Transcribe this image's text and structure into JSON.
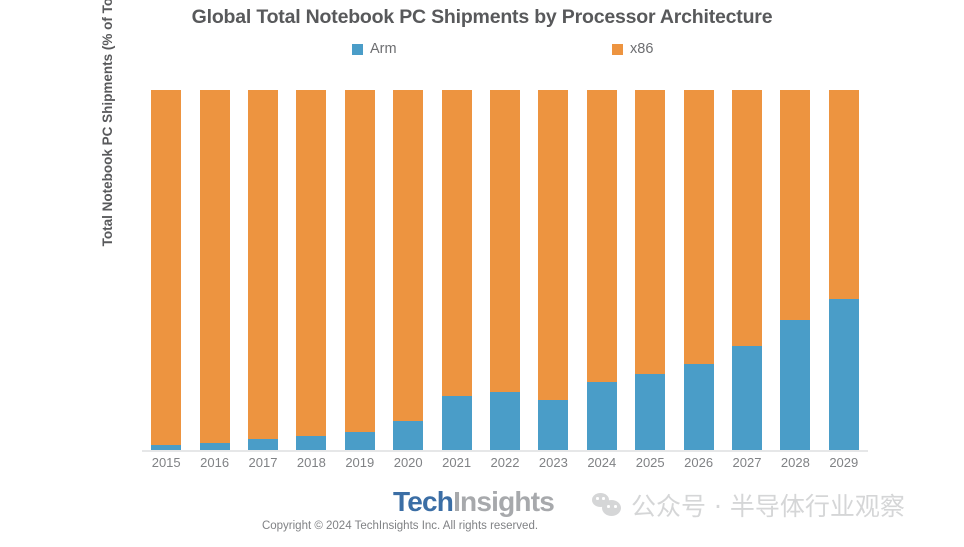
{
  "chart_data": {
    "type": "bar",
    "subtype": "stacked-100-percent",
    "title": "Global Total Notebook PC Shipments by Processor Architecture",
    "xlabel": "",
    "ylabel": "Total Notebook PC Shipments (% of Total)",
    "ylim": [
      0,
      100
    ],
    "grid": false,
    "legend_position": "top-center",
    "categories": [
      "2015",
      "2016",
      "2017",
      "2018",
      "2019",
      "2020",
      "2021",
      "2022",
      "2023",
      "2024",
      "2025",
      "2026",
      "2027",
      "2028",
      "2029"
    ],
    "series": [
      {
        "name": "Arm",
        "color": "#4a9dc8",
        "values": [
          1.5,
          2,
          3,
          4,
          5,
          8,
          15,
          16,
          14,
          19,
          21,
          24,
          29,
          36,
          42
        ]
      },
      {
        "name": "x86",
        "color": "#ed9440",
        "values": [
          98.5,
          98,
          97,
          96,
          95,
          92,
          85,
          84,
          86,
          81,
          79,
          76,
          71,
          64,
          58
        ]
      }
    ]
  },
  "legend": {
    "items": [
      {
        "label": "Arm",
        "color": "#4a9dc8"
      },
      {
        "label": "x86",
        "color": "#ed9440"
      }
    ]
  },
  "footer": {
    "brand_primary": "Tech",
    "brand_secondary": "Insights",
    "copyright": "Copyright © 2024 TechInsights Inc.  All rights reserved.",
    "watermark_text": "公众号 · 半导体行业观察",
    "watermark_icon": "wechat-icon"
  },
  "colors": {
    "arm": "#4a9dc8",
    "x86": "#ed9440",
    "title": "#58595b",
    "axis_text": "#808285",
    "baseline": "#e6e7e8",
    "brand_blue": "#3b6ea5",
    "brand_gray": "#a7a9ac"
  }
}
